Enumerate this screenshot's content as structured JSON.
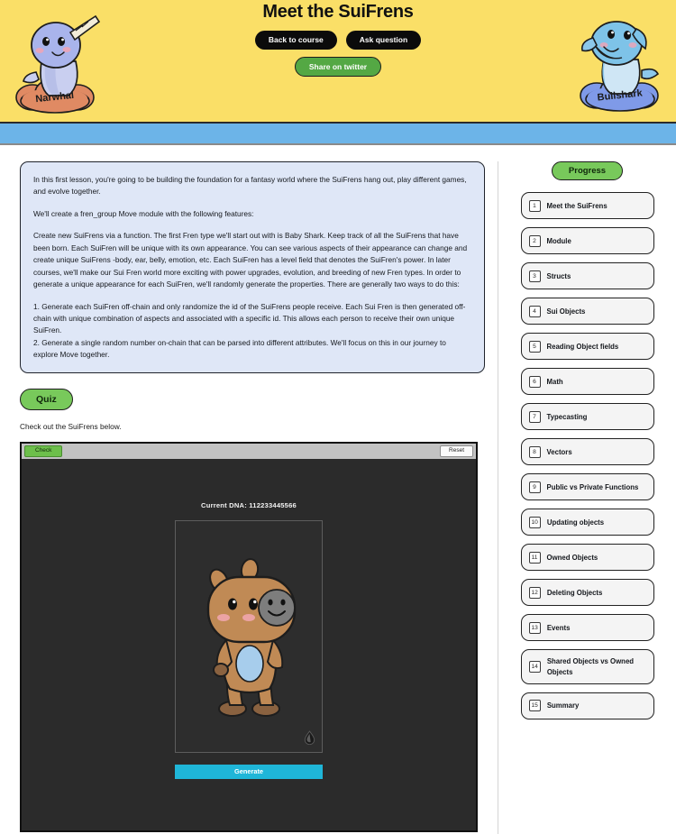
{
  "header": {
    "title": "Meet the SuiFrens",
    "buttons": [
      {
        "label": "Back to course",
        "style": "dark",
        "name": "back-to-course-button"
      },
      {
        "label": "Ask question",
        "style": "dark",
        "name": "ask-question-button"
      }
    ],
    "share_button": {
      "label": "Share on twitter",
      "name": "share-on-twitter-button"
    },
    "background_color": "#fadf67",
    "mascots": [
      {
        "name": "Narwhal",
        "label": "Narwhal",
        "body_color": "#a9b4ec",
        "cloud_color": "#e08a63"
      },
      {
        "name": "Bullshark",
        "label": "Bullshark",
        "body_color": "#7ec3e8",
        "cloud_color": "#7f9ae8"
      }
    ],
    "band_color": "#6cb4e8"
  },
  "lesson": {
    "intro_paragraphs": [
      "In this first lesson, you're going to be building the foundation for a fantasy world where the SuiFrens hang out, play different games, and evolve together.",
      "We'll create a fren_group Move module with the following features:",
      "Create new SuiFrens via a function. The first Fren type we'll start out with is Baby Shark. Keep track of all the SuiFrens that have been born. Each SuiFren will be unique with its own appearance. You can see various aspects of their appearance can change and create unique SuiFrens -body, ear, belly, emotion, etc. Each SuiFren has a level field that denotes the SuiFren's power. In later courses, we'll make our Sui Fren world more exciting with power upgrades, evolution, and breeding of new Fren types. In order to generate a unique appearance for each SuiFren, we'll randomly generate the properties. There are generally two ways to do this:",
      "1. Generate each SuiFren off-chain and only randomize the id of the SuiFrens people receive. Each Sui Fren is then generated off-chain with unique combination of aspects and associated with a specific id. This allows each person to receive their own unique SuiFren.",
      "2. Generate a single random number on-chain that can be parsed into different attributes. We'll focus on this in our journey to explore Move together."
    ],
    "quiz_badge": "Quiz",
    "quiz_note": "Check out the SuiFrens below."
  },
  "app": {
    "toolbar": {
      "check_label": "Check",
      "reset_label": "Reset"
    },
    "dna_text": "Current DNA: 112233445566",
    "generate_label": "Generate",
    "accent_color": "#1fb6d8",
    "stage_background": "#2b2b2b",
    "character": {
      "name": "capybara-fren",
      "body_color": "#c08a55",
      "belly_color": "#a7cdec",
      "face_patch_color": "#7d7d7d",
      "cheek_color": "#f0a5ad",
      "foot_color": "#8a6240"
    },
    "logo_icon": "sui-water-drop-icon"
  },
  "sidebar": {
    "progress_label": "Progress",
    "lessons": [
      {
        "num": "1",
        "label": "Meet the SuiFrens"
      },
      {
        "num": "2",
        "label": "Module"
      },
      {
        "num": "3",
        "label": "Structs"
      },
      {
        "num": "4",
        "label": "Sui Objects"
      },
      {
        "num": "5",
        "label": "Reading Object fields"
      },
      {
        "num": "6",
        "label": "Math"
      },
      {
        "num": "7",
        "label": "Typecasting"
      },
      {
        "num": "8",
        "label": "Vectors"
      },
      {
        "num": "9",
        "label": "Public vs Private Functions"
      },
      {
        "num": "10",
        "label": "Updating objects"
      },
      {
        "num": "11",
        "label": "Owned Objects"
      },
      {
        "num": "12",
        "label": "Deleting Objects"
      },
      {
        "num": "13",
        "label": "Events"
      },
      {
        "num": "14",
        "label": "Shared Objects vs Owned Objects"
      },
      {
        "num": "15",
        "label": "Summary"
      }
    ]
  }
}
